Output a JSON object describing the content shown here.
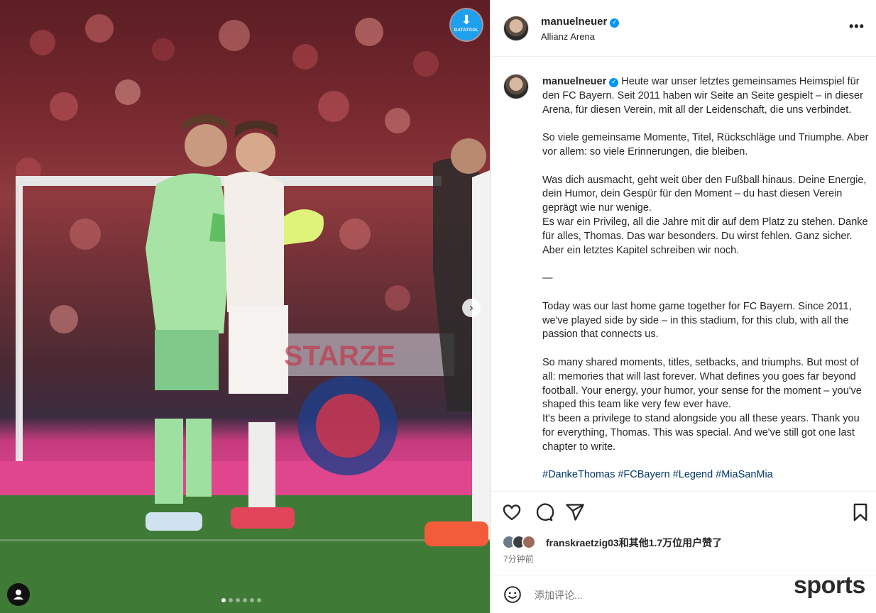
{
  "photo": {
    "download_badge": {
      "label": "DATATOOL",
      "icon": "download-icon"
    },
    "next_icon": "›",
    "carousel": {
      "count": 6,
      "active_index": 0
    }
  },
  "post": {
    "author": {
      "username": "manuelneuer",
      "verified": true,
      "location": "Allianz Arena"
    },
    "more_label": "•••",
    "caption": {
      "text_lead": "Heute war unser letztes gemeinsames Heimspiel für den FC Bayern. Seit 2011 haben wir Seite an Seite gespielt – in dieser Arena, für diesen Verein, mit all der Leidenschaft, die uns verbindet.",
      "p2": "So viele gemeinsame Momente, Titel, Rückschläge und Triumphe. Aber vor allem: so viele Erinnerungen, die bleiben.",
      "p3a": "Was dich ausmacht, geht weit über den Fußball hinaus. Deine Energie, dein Humor, dein Gespür für den Moment – du hast diesen Verein geprägt wie nur wenige.",
      "p3b": "Es war ein Privileg, all die Jahre mit dir auf dem Platz zu stehen. Danke für alles, Thomas. Das war besonders. Du wirst fehlen. Ganz sicher. Aber ein letztes Kapitel schreiben wir noch.",
      "divider": "—",
      "p4": "Today was our last home game together for FC Bayern. Since 2011, we've played side by side – in this stadium, for this club, with all the passion that connects us.",
      "p5a": "So many shared moments, titles, setbacks, and triumphs. But most of all: memories that will last forever. What defines you goes far beyond football. Your energy, your humor, your sense for the moment – you've shaped this team like very few ever have.",
      "p5b": "It's been a privilege to stand alongside you all these years. Thank you for everything, Thomas. This was special. And we've still got one last chapter to write.",
      "hashtags": [
        "#DankeThomas",
        "#FCBayern",
        "#Legend",
        "#MiaSanMia"
      ]
    },
    "likes": {
      "text": "franskraetzig03和其他1.7万位用户赞了"
    },
    "time": "7分钟前",
    "comment": {
      "placeholder": "添加评论..."
    }
  },
  "watermark": "sports",
  "colors": {
    "verified": "#0095f6",
    "hashtag": "#00376b",
    "muted": "#737373",
    "badge": "#1fa0ef"
  }
}
